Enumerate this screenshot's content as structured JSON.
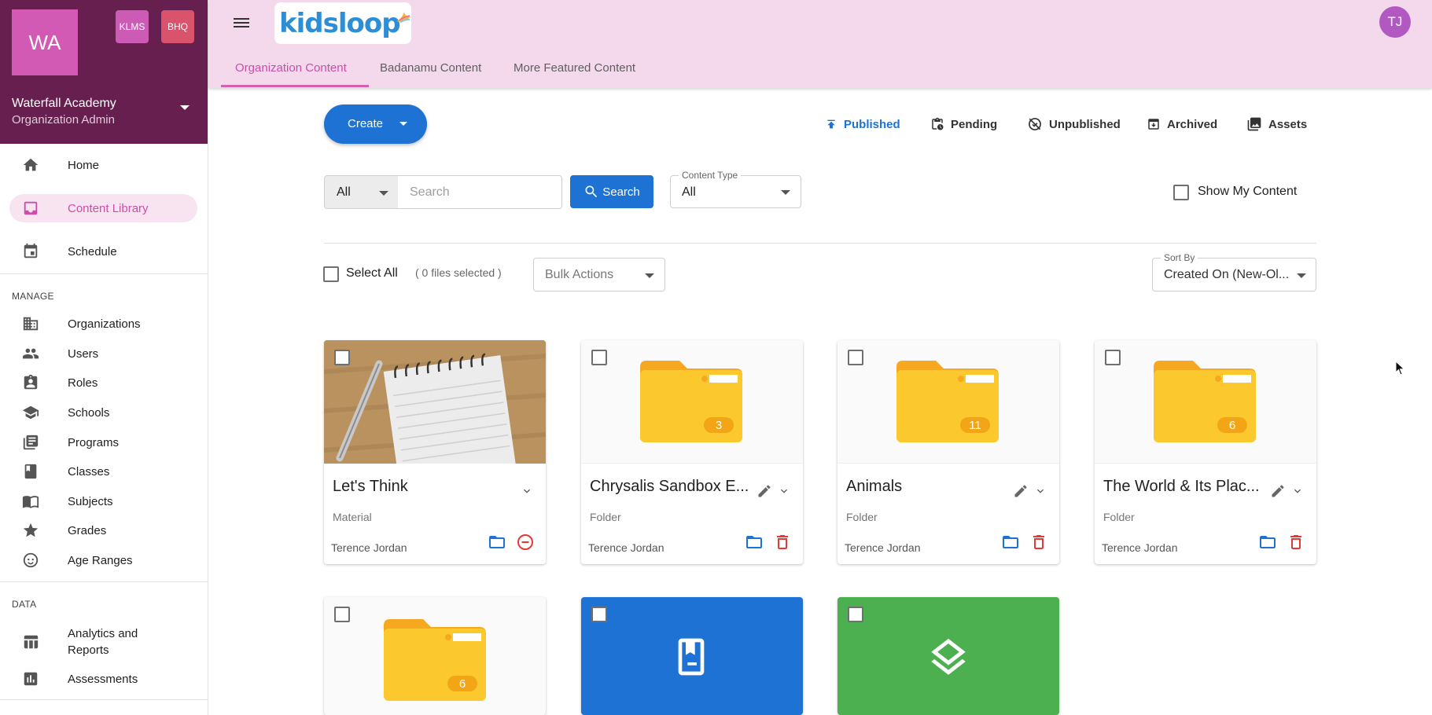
{
  "org": {
    "initials": "WA",
    "chips": [
      "KLMS",
      "BHQ"
    ],
    "name": "Waterfall Academy",
    "role": "Organization Admin"
  },
  "sidebar": {
    "items": [
      {
        "label": "Home",
        "icon": "home-icon"
      },
      {
        "label": "Content Library",
        "icon": "inbox-icon",
        "active": true
      },
      {
        "label": "Schedule",
        "icon": "calendar-icon"
      }
    ],
    "manage_heading": "MANAGE",
    "manage_items": [
      {
        "label": "Organizations",
        "icon": "building-icon"
      },
      {
        "label": "Users",
        "icon": "people-icon"
      },
      {
        "label": "Roles",
        "icon": "badge-icon"
      },
      {
        "label": "Schools",
        "icon": "school-icon"
      },
      {
        "label": "Programs",
        "icon": "library-icon"
      },
      {
        "label": "Classes",
        "icon": "book-icon"
      },
      {
        "label": "Subjects",
        "icon": "menu-book-icon"
      },
      {
        "label": "Grades",
        "icon": "star-icon"
      },
      {
        "label": "Age Ranges",
        "icon": "face-icon"
      }
    ],
    "data_heading": "DATA",
    "data_items": [
      {
        "label": "Analytics and Reports",
        "icon": "table-icon"
      },
      {
        "label": "Assessments",
        "icon": "bar-chart-icon"
      }
    ]
  },
  "topbar": {
    "logo_text": "kidsloop",
    "user_initials": "TJ",
    "tabs": [
      "Organization Content",
      "Badanamu Content",
      "More Featured Content"
    ]
  },
  "toolbar": {
    "create_label": "Create",
    "status_tabs": [
      "Published",
      "Pending",
      "Unpublished",
      "Archived",
      "Assets"
    ],
    "active_status": "Published"
  },
  "filters": {
    "scope_value": "All",
    "search_placeholder": "Search",
    "search_button": "Search",
    "content_type_label": "Content Type",
    "content_type_value": "All",
    "show_my_content": "Show My Content"
  },
  "selection": {
    "select_all": "Select All",
    "files_selected": "( 0 files selected )",
    "bulk_actions": "Bulk Actions",
    "sort_label": "Sort By",
    "sort_value": "Created On (New-Ol..."
  },
  "cards": [
    {
      "title": "Let's Think",
      "type": "Material",
      "owner": "Terence Jordan",
      "thumb": "notepad-photo"
    },
    {
      "title": "Chrysalis Sandbox E...",
      "type": "Folder",
      "owner": "Terence Jordan",
      "count": "3"
    },
    {
      "title": "Animals",
      "type": "Folder",
      "owner": "Terence Jordan",
      "count": "11"
    },
    {
      "title": "The World & Its Plac...",
      "type": "Folder",
      "owner": "Terence Jordan",
      "count": "6"
    },
    {
      "count": "6",
      "thumb": "folder"
    },
    {
      "thumb": "book-icon",
      "color": "#1e72d4"
    },
    {
      "thumb": "layers-icon",
      "color": "#4caf50"
    }
  ],
  "colors": {
    "brand_pink": "#c84fa8",
    "sidebar_header": "#661f4f",
    "primary_blue": "#1e72d4",
    "folder_yellow": "#fbc82e",
    "delete_red": "#e53935"
  }
}
